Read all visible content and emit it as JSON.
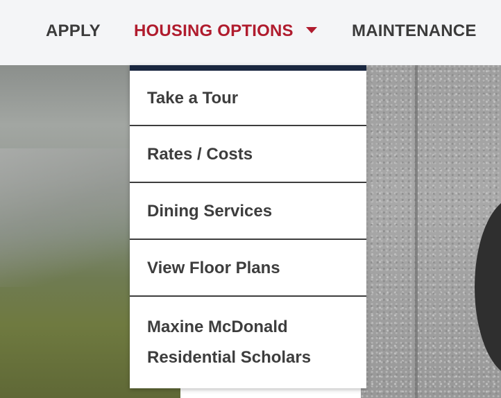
{
  "nav": {
    "apply_label": "APPLY",
    "housing_label": "HOUSING OPTIONS",
    "maintenance_label": "MAINTENANCE"
  },
  "colors": {
    "active": "#b01c2e",
    "nav_text": "#3b3b3b",
    "dropdown_top_border": "#1a2740"
  },
  "dropdown": {
    "items": [
      {
        "label": "Take a Tour"
      },
      {
        "label": "Rates / Costs"
      },
      {
        "label": "Dining Services"
      },
      {
        "label": "View Floor Plans"
      },
      {
        "label_line1": "Maxine McDonald",
        "label_line2": "Residential Scholars"
      }
    ]
  },
  "icons": {
    "housing_caret": "caret-down-icon"
  }
}
